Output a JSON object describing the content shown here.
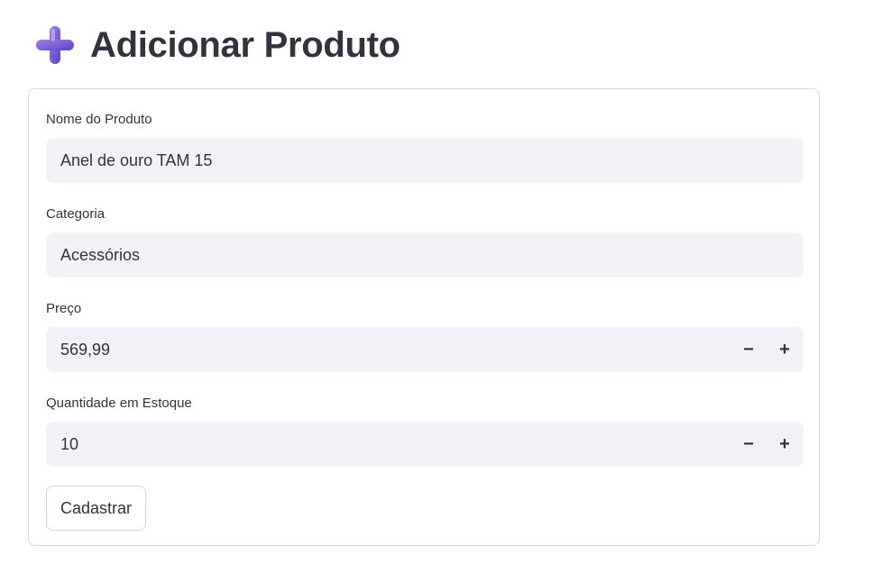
{
  "header": {
    "icon": "heavy-plus-icon",
    "icon_color": "#7b5cd6",
    "title": "Adicionar Produto"
  },
  "form": {
    "fields": [
      {
        "label": "Nome do Produto",
        "value": "Anel de ouro TAM 15",
        "type": "text"
      },
      {
        "label": "Categoria",
        "value": "Acessórios",
        "type": "text"
      },
      {
        "label": "Preço",
        "value": "569,99",
        "type": "number"
      },
      {
        "label": "Quantidade em Estoque",
        "value": "10",
        "type": "number"
      }
    ],
    "stepper": {
      "minus": "−",
      "plus": "+"
    },
    "submit_label": "Cadastrar"
  },
  "colors": {
    "text": "#31333f",
    "input_background": "#f0f2f6",
    "border": "#d9dadf"
  }
}
